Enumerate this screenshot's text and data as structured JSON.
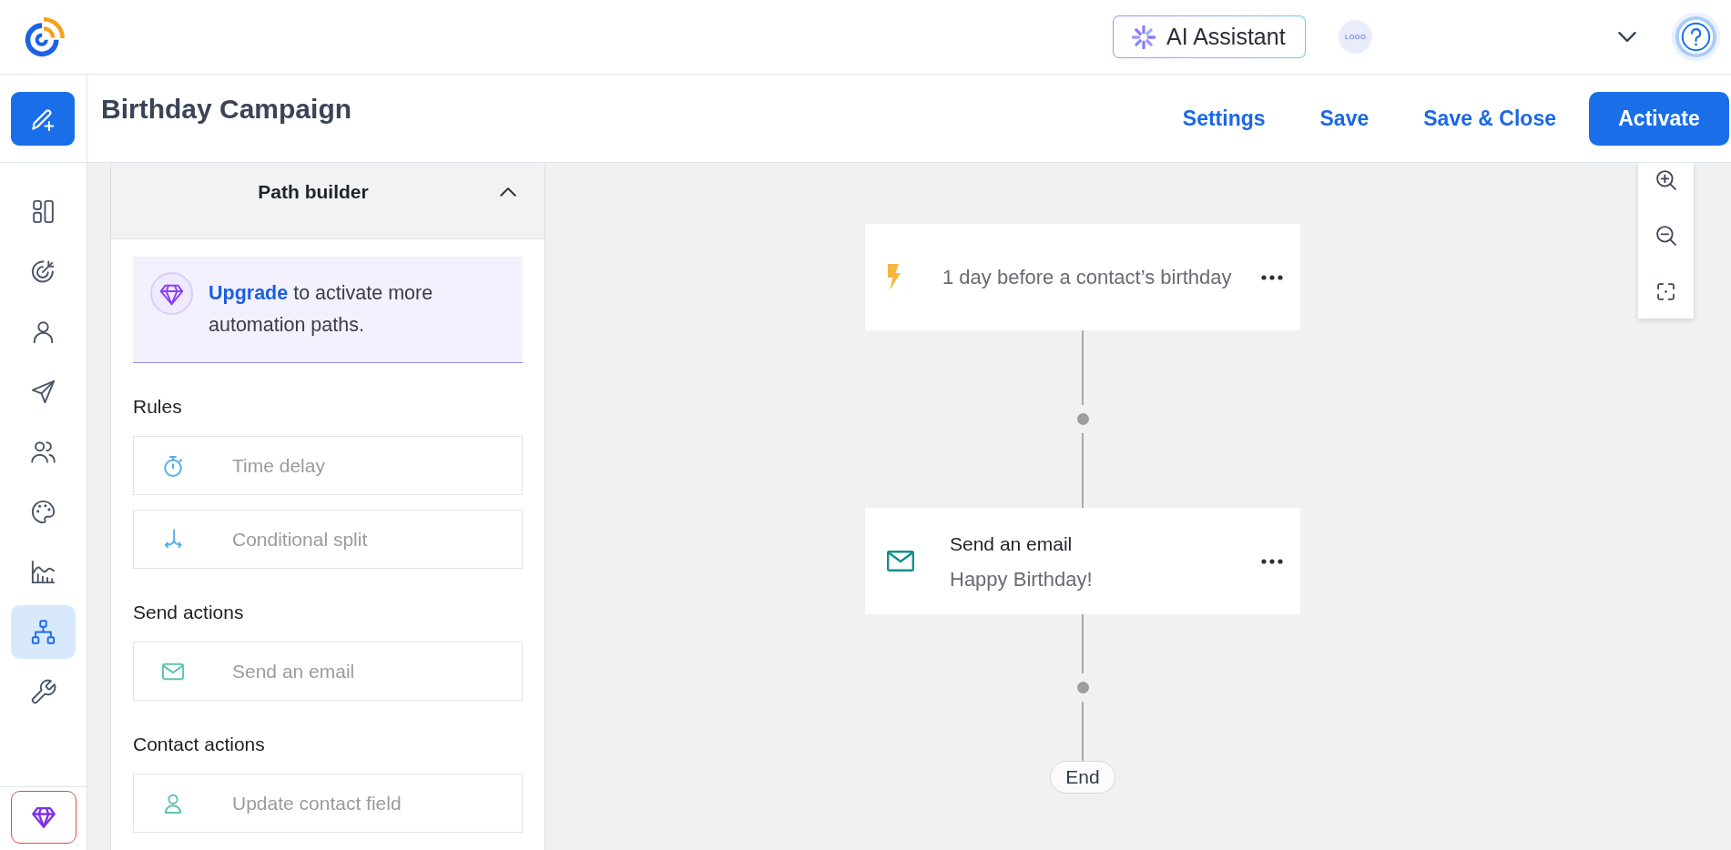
{
  "top_bar": {
    "ai_assistant": "AI Assistant",
    "account_logo": "LOGO"
  },
  "rail": {
    "items": [
      {
        "selected": false
      },
      {
        "selected": false
      },
      {
        "selected": false
      },
      {
        "selected": false
      },
      {
        "selected": false
      },
      {
        "selected": false
      },
      {
        "selected": false
      },
      {
        "selected": true
      },
      {
        "selected": false
      }
    ]
  },
  "header": {
    "title": "Birthday Campaign",
    "actions": [
      {
        "label": "Settings",
        "kind": "link"
      },
      {
        "label": "Save",
        "kind": "link"
      },
      {
        "label": "Save & Close",
        "kind": "link"
      },
      {
        "label": "Activate",
        "kind": "primary"
      }
    ]
  },
  "panel": {
    "title": "Path builder",
    "expanded": true,
    "upgrade": {
      "link": "Upgrade",
      "text": "to activate more automation paths."
    },
    "sections": [
      {
        "heading": "Rules",
        "items": [
          {
            "kind": "delay",
            "label": "Time delay"
          },
          {
            "kind": "split",
            "label": "Conditional split"
          }
        ]
      },
      {
        "heading": "Send actions",
        "items": [
          {
            "kind": "email",
            "label": "Send an email"
          }
        ]
      },
      {
        "heading": "Contact actions",
        "items": [
          {
            "kind": "contact",
            "label": "Update contact field"
          }
        ]
      }
    ]
  },
  "flow": {
    "steps": [
      {
        "kind": "trigger",
        "text": "1 day before a contact’s birthday"
      },
      {
        "kind": "email",
        "title": "Send an email",
        "subtitle": "Happy Birthday!"
      }
    ],
    "end_label": "End"
  }
}
